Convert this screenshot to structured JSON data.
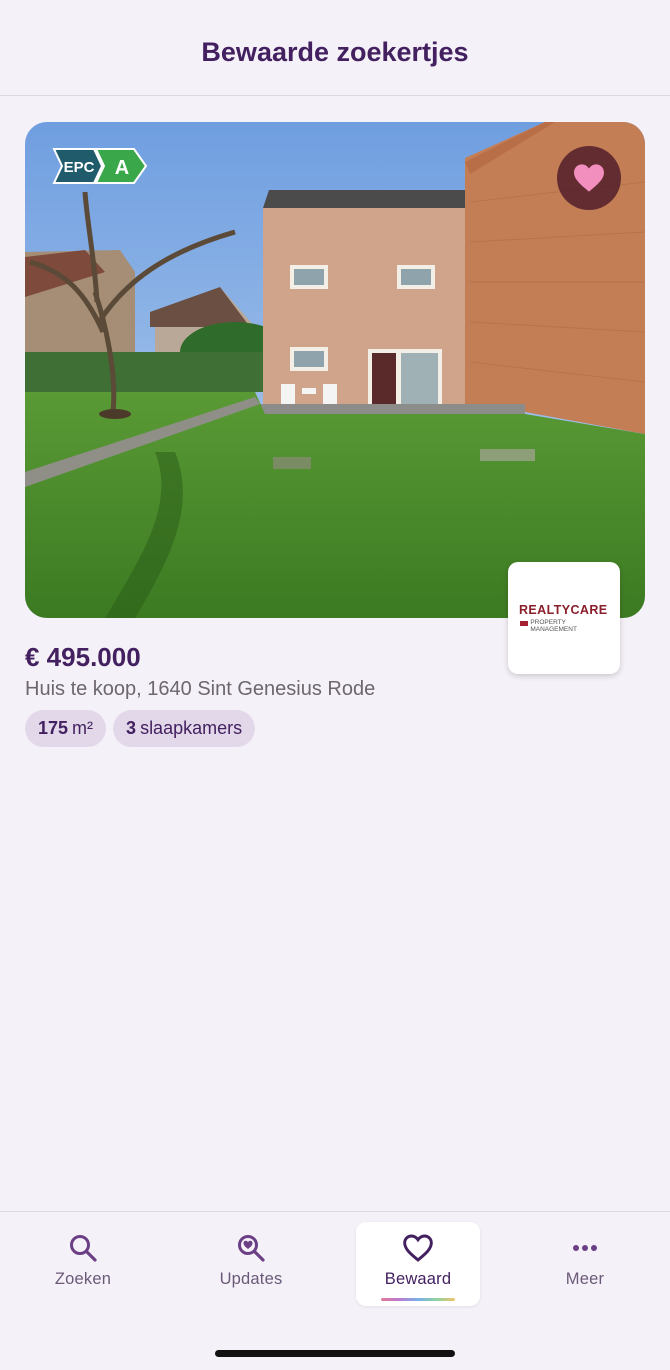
{
  "header": {
    "title": "Bewaarde zoekertjes"
  },
  "listing": {
    "epc_label": "EPC",
    "epc_grade": "A",
    "price": "€ 495.000",
    "address": "Huis te koop, 1640 Sint Genesius Rode",
    "chips": [
      {
        "value": "175",
        "unit": "m²"
      },
      {
        "value": "3",
        "unit": "slaapkamers"
      }
    ],
    "agency": {
      "logo_text": "REALTYCARE",
      "logo_subtext": "PROPERTY MANAGEMENT"
    },
    "favorite": true
  },
  "tabbar": {
    "items": [
      {
        "label": "Zoeken",
        "icon": "search-icon"
      },
      {
        "label": "Updates",
        "icon": "search-heart-icon"
      },
      {
        "label": "Bewaard",
        "icon": "heart-outline-icon",
        "active": true
      },
      {
        "label": "Meer",
        "icon": "more-dots-icon"
      }
    ]
  },
  "colors": {
    "brand": "#43205f",
    "epc_green": "#3aa84a",
    "epc_dark": "#1f5b6b",
    "heart_pink": "#f28fbf"
  }
}
